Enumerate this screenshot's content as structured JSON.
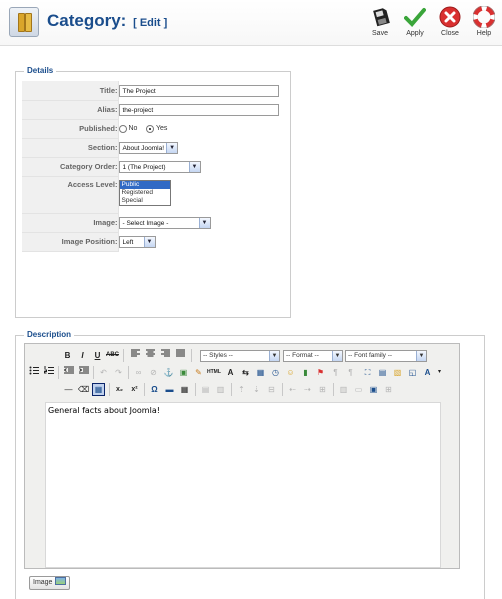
{
  "header": {
    "title": "Category:",
    "subtitle": "[ Edit ]",
    "icon": "category-books-icon",
    "toolbar": [
      {
        "label": "Save",
        "icon": "save-floppy-icon"
      },
      {
        "label": "Apply",
        "icon": "apply-check-icon",
        "color": "#3aa53a"
      },
      {
        "label": "Close",
        "icon": "close-x-icon",
        "color": "#d93030"
      },
      {
        "label": "Help",
        "icon": "help-lifebuoy-icon",
        "color": "#d93030"
      }
    ]
  },
  "details": {
    "legend": "Details",
    "title_label": "Title:",
    "title_value": "The Project",
    "alias_label": "Alias:",
    "alias_value": "the-project",
    "published_label": "Published:",
    "published_no": "No",
    "published_yes": "Yes",
    "published_selected": "Yes",
    "section_label": "Section:",
    "section_value": "About Joomla!",
    "order_label": "Category Order:",
    "order_value": "1 (The Project)",
    "access_label": "Access Level:",
    "access_options": [
      "Public",
      "Registered",
      "Special"
    ],
    "access_selected": "Public",
    "image_label": "Image:",
    "image_value": "- Select Image -",
    "image_position_label": "Image Position:",
    "image_position_value": "Left"
  },
  "description": {
    "legend": "Description",
    "styles_placeholder": "-- Styles --",
    "format_placeholder": "-- Format --",
    "font_family_placeholder": "-- Font family --",
    "content": "General facts about Joomla!",
    "image_button": "Image"
  }
}
